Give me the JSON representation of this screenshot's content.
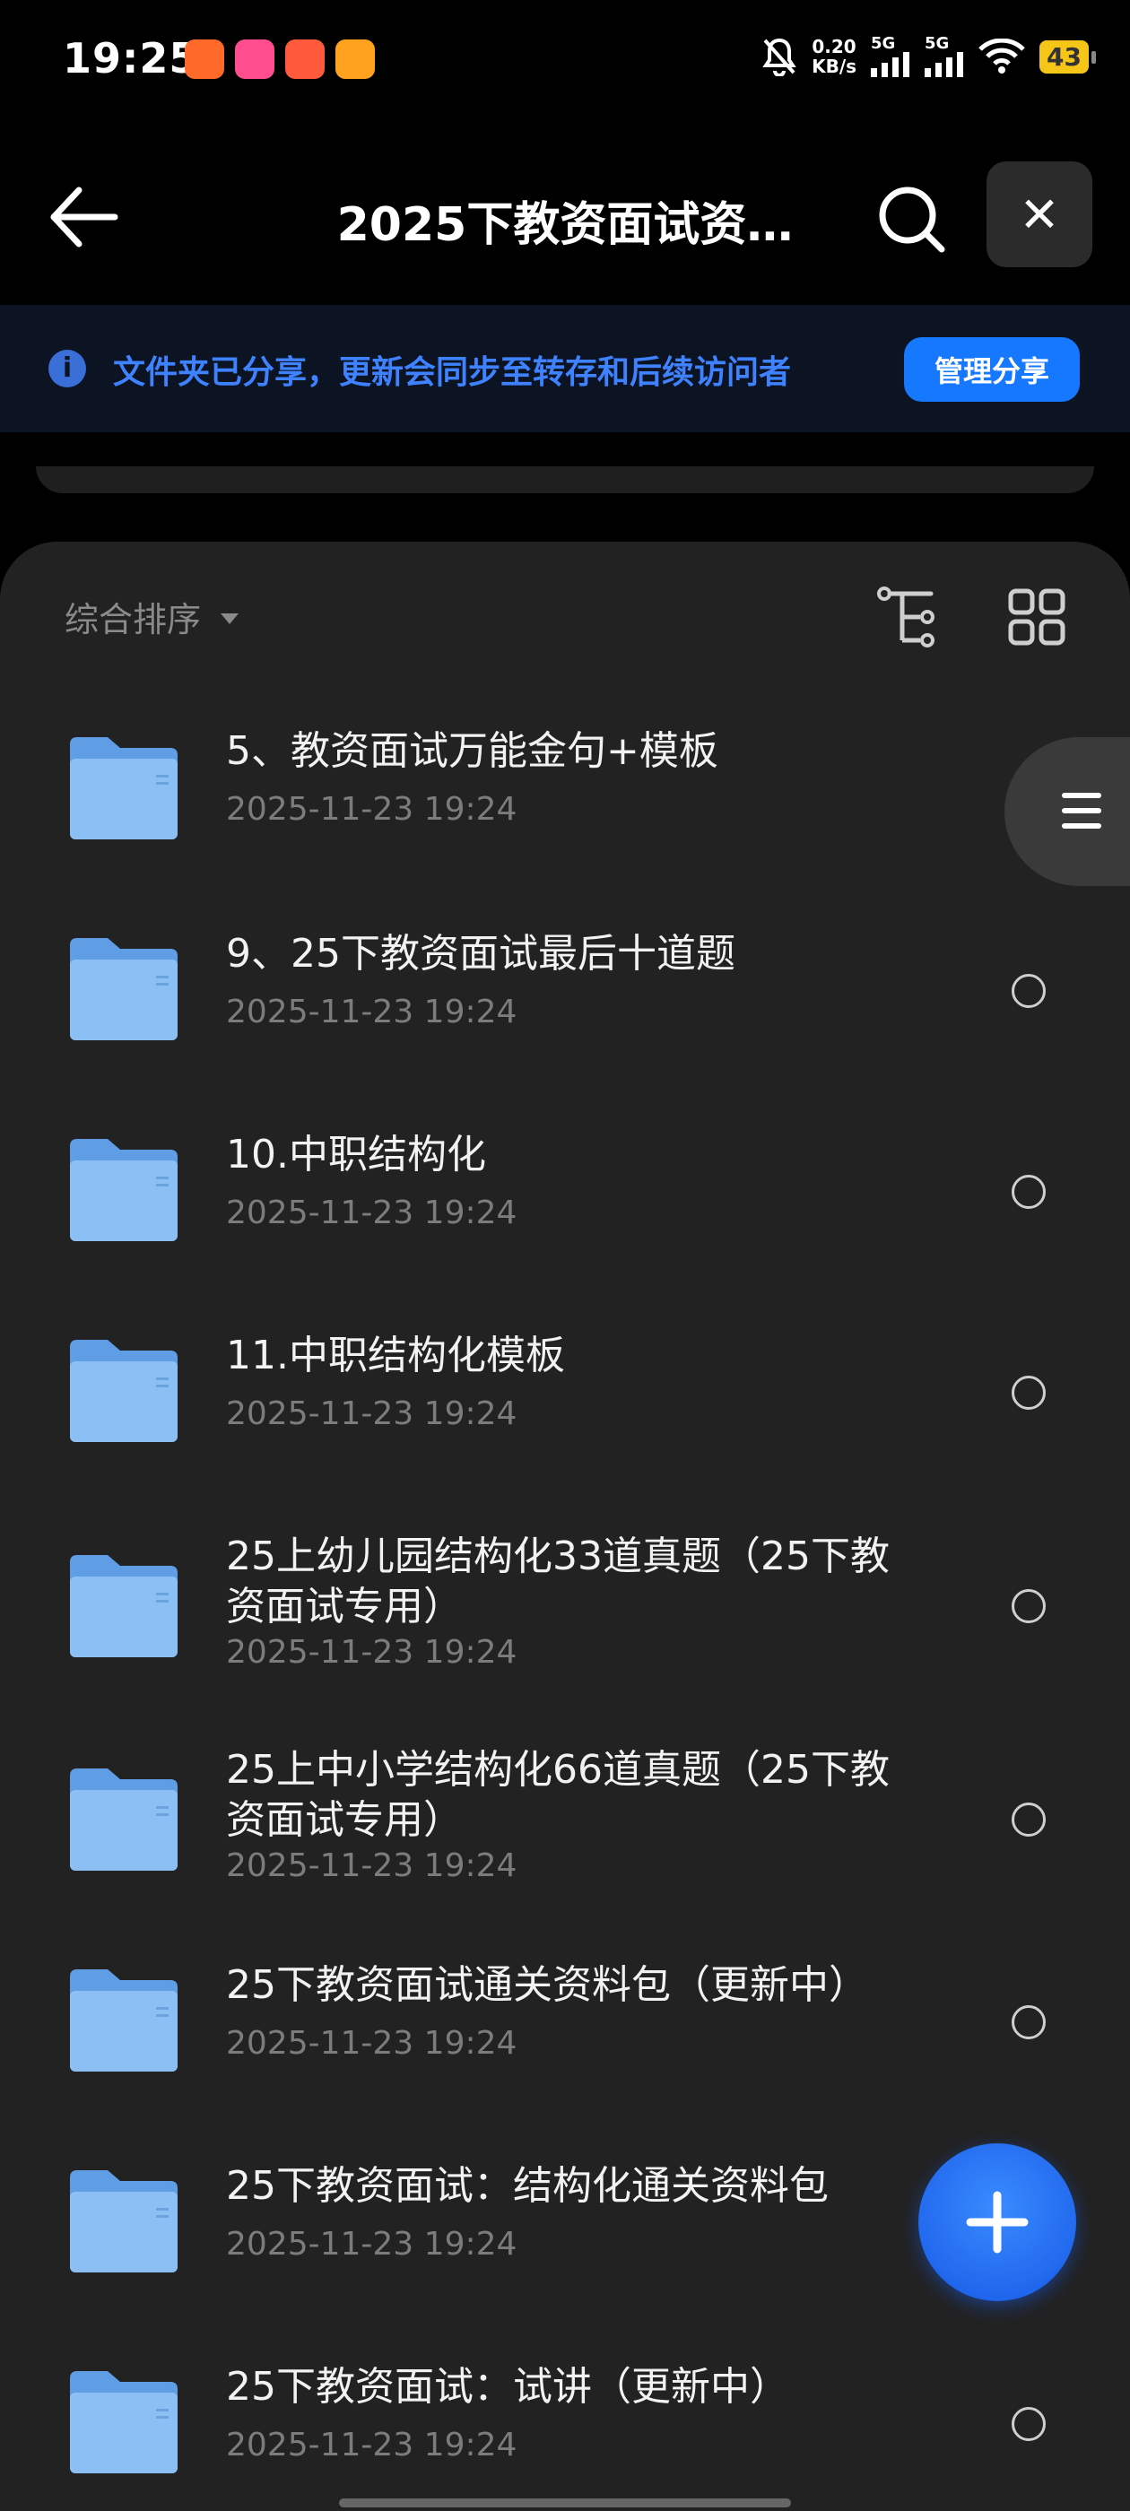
{
  "status_bar": {
    "time": "19:25",
    "net_speed_value": "0.20",
    "net_speed_unit": "KB/s",
    "sim1": "5G",
    "sim2": "5G",
    "battery": "43"
  },
  "header": {
    "title": "2025下教资面试资…"
  },
  "banner": {
    "text": "文件夹已分享，更新会同步至转存和后续访问者",
    "manage_label": "管理分享"
  },
  "sort": {
    "label": "综合排序"
  },
  "colors": {
    "accent": "#1677ff",
    "banner_text": "#3f82ff",
    "folder": "#7fb6f2"
  },
  "files": [
    {
      "name": "5、教资面试万能金句+模板",
      "date": "2025-11-23 19:24"
    },
    {
      "name": "9、25下教资面试最后十道题",
      "date": "2025-11-23 19:24"
    },
    {
      "name": "10.中职结构化",
      "date": "2025-11-23 19:24"
    },
    {
      "name": "11.中职结构化模板",
      "date": "2025-11-23 19:24"
    },
    {
      "name": "25上幼儿园结构化33道真题（25下教资面试专用）",
      "date": "2025-11-23 19:24"
    },
    {
      "name": "25上中小学结构化66道真题（25下教资面试专用）",
      "date": "2025-11-23 19:24"
    },
    {
      "name": "25下教资面试通关资料包（更新中）",
      "date": "2025-11-23 19:24"
    },
    {
      "name": "25下教资面试：结构化通关资料包",
      "date": "2025-11-23 19:24"
    },
    {
      "name": "25下教资面试：试讲（更新中）",
      "date": "2025-11-23 19:24"
    }
  ]
}
